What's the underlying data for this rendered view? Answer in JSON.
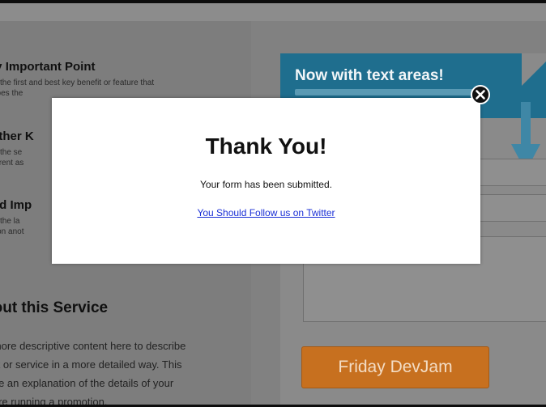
{
  "left_panel": {
    "points": [
      {
        "title": "ery Important Point",
        "lines": [
          "is is the first and best key benefit or feature that",
          "scribes the"
        ]
      },
      {
        "title": "nother K",
        "lines": [
          "is is the se",
          "different as"
        ]
      },
      {
        "title": "hird Imp",
        "lines": [
          "is is the la",
          "ention anot"
        ]
      }
    ],
    "about": {
      "title": "bout this Service",
      "lines": [
        "e more descriptive content here to describe",
        "luct or service in a more detailed way. This",
        "o be an explanation of the details of your",
        "u are running a promotion."
      ]
    }
  },
  "right_panel": {
    "ribbon_title": "Now with text areas!",
    "cta_label": "Friday DevJam"
  },
  "modal": {
    "title": "Thank You!",
    "message": "Your form has been submitted.",
    "link": "You Should Follow us on Twitter",
    "close_icon": "close-icon"
  },
  "colors": {
    "ribbon": "#1f6e8e",
    "cta": "#c7701f",
    "link": "#1a2fd6",
    "overlay": "#818181"
  }
}
